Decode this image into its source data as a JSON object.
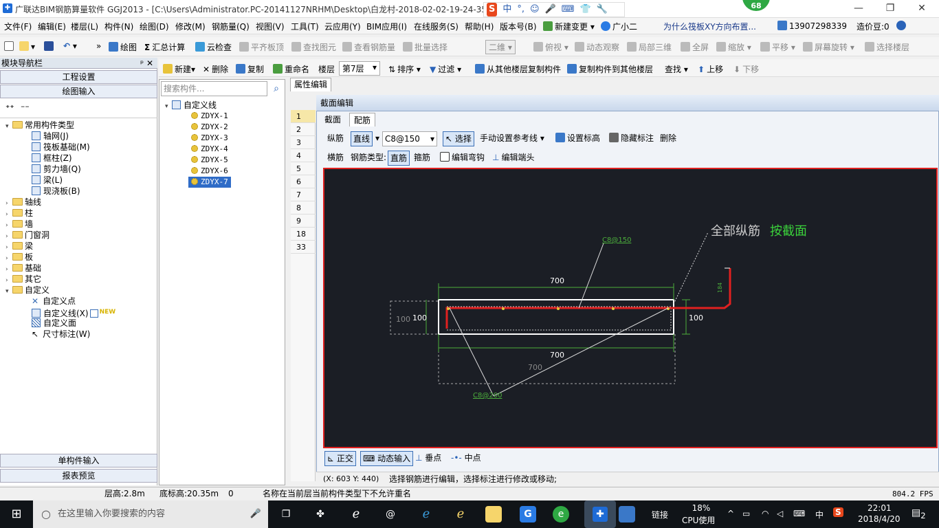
{
  "titlebar": {
    "title": "广联达BIM钢筋算量软件 GGJ2013 - [C:\\Users\\Administrator.PC-20141127NRHM\\Desktop\\白龙村-2018-02-02-19-24-35",
    "ime": [
      "S",
      "中",
      "°,",
      "☺",
      "🎤",
      "⌨",
      "👕",
      "🔧"
    ],
    "badge": "68",
    "min": "—",
    "restore": "❐",
    "close": "✕"
  },
  "menu": {
    "items": [
      "文件(F)",
      "编辑(E)",
      "楼层(L)",
      "构件(N)",
      "绘图(D)",
      "修改(M)",
      "钢筋量(Q)",
      "视图(V)",
      "工具(T)",
      "云应用(Y)",
      "BIM应用(I)",
      "在线服务(S)",
      "帮助(H)",
      "版本号(B)",
      "新建变更",
      "广小二"
    ],
    "news": "为什么筏板XY方向布置...",
    "phone": "13907298339",
    "price": "造价豆:0"
  },
  "toolbar1": {
    "items": [
      "绘图",
      "汇总计算",
      "云检查",
      "平齐板顶",
      "查找图元",
      "查看钢筋量",
      "批量选择",
      "二维",
      "俯视",
      "动态观察",
      "局部三维",
      "全屏",
      "缩放",
      "平移",
      "屏幕旋转",
      "选择楼层"
    ]
  },
  "toolbar2": {
    "items": [
      "新建",
      "删除",
      "复制",
      "重命名",
      "楼层",
      "第7层",
      "排序",
      "过滤",
      "从其他楼层复制构件",
      "复制构件到其他楼层",
      "查找",
      "上移",
      "下移"
    ]
  },
  "leftnav": {
    "title": "模块导航栏",
    "pin": "ᵖ ✕",
    "sections": [
      "工程设置",
      "绘图输入"
    ],
    "tree_common": "常用构件类型",
    "common_items": [
      "轴网(J)",
      "筏板基础(M)",
      "框柱(Z)",
      "剪力墙(Q)",
      "梁(L)",
      "现浇板(B)"
    ],
    "folders": [
      "轴线",
      "柱",
      "墙",
      "门窗洞",
      "梁",
      "板",
      "基础",
      "其它"
    ],
    "custom": "自定义",
    "custom_items": [
      "自定义点",
      "自定义线(X)",
      "自定义面",
      "尺寸标注(W)"
    ],
    "new_badge": "NEW",
    "bottom": [
      "单构件输入",
      "报表预览"
    ]
  },
  "midpanel": {
    "search_placeholder": "搜索构件...",
    "root": "自定义线",
    "items": [
      "ZDYX-1",
      "ZDYX-2",
      "ZDYX-3",
      "ZDYX-4",
      "ZDYX-5",
      "ZDYX-6",
      "ZDYX-7"
    ]
  },
  "prop": {
    "tab": "属性编辑",
    "rows": [
      "1",
      "2",
      "3",
      "4",
      "5",
      "6",
      "7",
      "8",
      "9",
      "18",
      "33"
    ]
  },
  "editor": {
    "title": "截面编辑",
    "tabs": [
      "截面",
      "配筋"
    ],
    "row1": [
      "纵筋",
      "直线",
      "C8@150",
      "选择",
      "手动设置参考线",
      "设置标高",
      "隐藏标注",
      "删除"
    ],
    "row2": [
      "横筋",
      "钢筋类型:",
      "直筋",
      "箍筋",
      "编辑弯钩",
      "编辑端头"
    ],
    "canvas": {
      "label_all": "全部纵筋",
      "label_by": "按截面",
      "top_rebar": "C8@150",
      "bottom_rebar": "C8@200",
      "dim_top": "700",
      "dim_bottom": "700",
      "dim_bottom2": "700",
      "dim_left": "100",
      "dim_left2": "100",
      "dim_right": "100",
      "hook": "184"
    },
    "bottom": [
      "正交",
      "动态输入",
      "垂点",
      "中点"
    ],
    "coords": "(X: 603 Y: 440)",
    "hint": "选择钢筋进行编辑，选择标注进行修改或移动;"
  },
  "statusbar": {
    "floor_h": "层高:2.8m",
    "base_h": "底标高:20.35m",
    "zero": "0",
    "msg": "名称在当前层当前构件类型下不允许重名",
    "fps": "804.2 FPS"
  },
  "taskbar": {
    "search": "在这里输入你要搜索的内容",
    "link": "链接",
    "cpu_pct": "18%",
    "cpu_label": "CPU使用",
    "lang": "中",
    "time": "22:01",
    "date": "2018/4/20",
    "notif": "2"
  }
}
